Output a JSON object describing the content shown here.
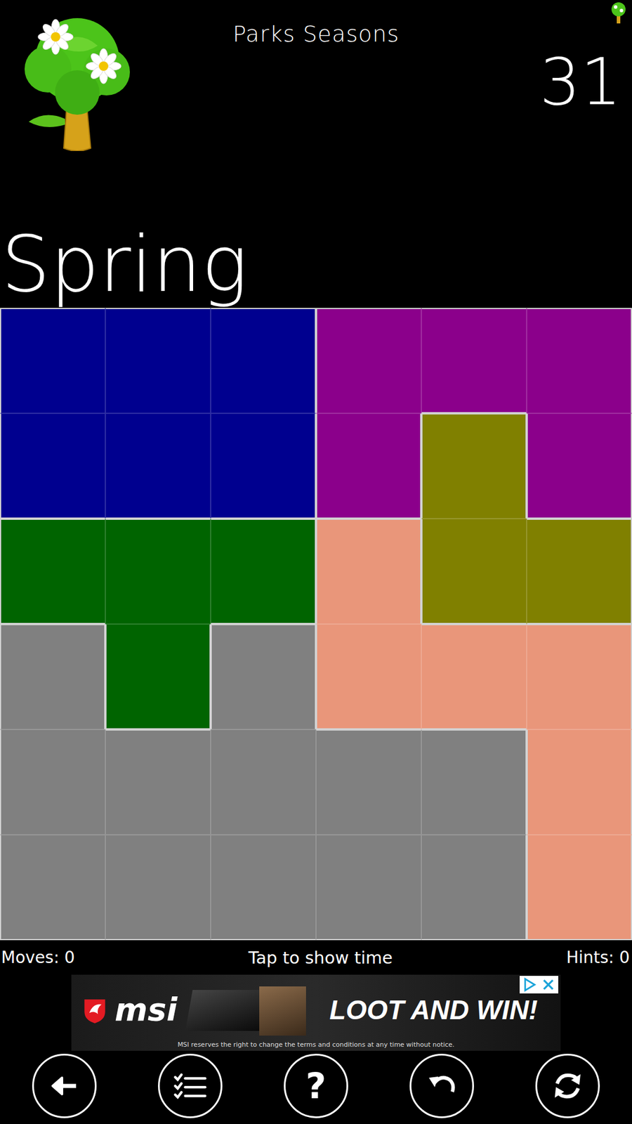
{
  "app": {
    "title": "Parks Seasons",
    "level": "31"
  },
  "season": "Spring",
  "regions": [
    {
      "id": "blue",
      "color": "#00008f"
    },
    {
      "id": "purple",
      "color": "#8b008b"
    },
    {
      "id": "olive",
      "color": "#808000"
    },
    {
      "id": "green",
      "color": "#006400"
    },
    {
      "id": "salmon",
      "color": "#e9967a"
    },
    {
      "id": "gray",
      "color": "#808080"
    }
  ],
  "grid": [
    [
      "blue",
      "blue",
      "blue",
      "purple",
      "purple",
      "purple"
    ],
    [
      "blue",
      "blue",
      "blue",
      "purple",
      "olive",
      "purple"
    ],
    [
      "green",
      "green",
      "green",
      "salmon",
      "olive",
      "olive"
    ],
    [
      "gray",
      "green",
      "gray",
      "salmon",
      "salmon",
      "salmon"
    ],
    [
      "gray",
      "gray",
      "gray",
      "gray",
      "gray",
      "salmon"
    ],
    [
      "gray",
      "gray",
      "gray",
      "gray",
      "gray",
      "salmon"
    ]
  ],
  "status": {
    "moves": "Moves: 0",
    "timer": "Tap to show time",
    "hints": "Hints: 0"
  },
  "ad": {
    "brand": "msi",
    "headline": "LOOT AND WIN!",
    "disclaimer": "MSI reserves the right to change the terms and conditions at any time without notice."
  },
  "toolbar": [
    {
      "kind": "back"
    },
    {
      "kind": "list"
    },
    {
      "kind": "help",
      "label": "?"
    },
    {
      "kind": "undo"
    },
    {
      "kind": "refresh"
    }
  ]
}
